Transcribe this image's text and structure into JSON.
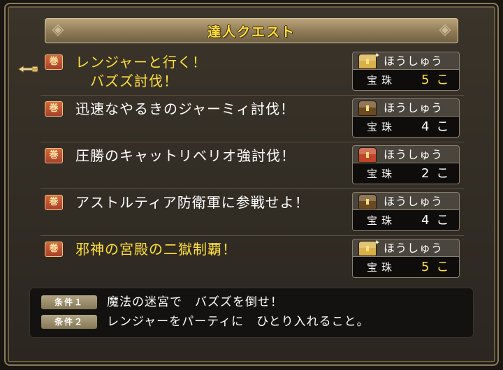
{
  "window": {
    "title": "達人クエスト"
  },
  "quests": [
    {
      "label": "レンジャーと行く！\n　バズズ討伐！",
      "highlight": true,
      "selected": true,
      "reward_header": "ほうしゅう",
      "reward_item": "宝珠",
      "reward_qty": "5こ",
      "chest_color": "#d9b04a",
      "chest_sparkle": true
    },
    {
      "label": "迅速なやるきのジャーミィ討伐！",
      "highlight": false,
      "selected": false,
      "reward_header": "ほうしゅう",
      "reward_item": "宝珠",
      "reward_qty": "4こ",
      "chest_color": "#6b4a22",
      "chest_sparkle": false
    },
    {
      "label": "圧勝のキャットリベリオ強討伐！",
      "highlight": false,
      "selected": false,
      "reward_header": "ほうしゅう",
      "reward_item": "宝珠",
      "reward_qty": "2こ",
      "chest_color": "#c0442a",
      "chest_sparkle": false
    },
    {
      "label": "アストルティア防衛軍に参戦せよ！",
      "highlight": false,
      "selected": false,
      "reward_header": "ほうしゅう",
      "reward_item": "宝珠",
      "reward_qty": "4こ",
      "chest_color": "#6b4a22",
      "chest_sparkle": false
    },
    {
      "label": "邪神の宮殿の二獄制覇！",
      "highlight": true,
      "selected": false,
      "reward_header": "ほうしゅう",
      "reward_item": "宝珠",
      "reward_qty": "5こ",
      "chest_color": "#d9b04a",
      "chest_sparkle": true
    }
  ],
  "conditions": [
    {
      "badge": "条件１",
      "text": "魔法の迷宮で　バズズを倒せ！"
    },
    {
      "badge": "条件２",
      "text": "レンジャーをパーティに　ひとり入れること。"
    }
  ],
  "icons": {
    "quest_icon": "quest-scroll-icon",
    "reward_icon": "treasure-chest-icon",
    "cursor_icon": "hand-cursor-icon",
    "title_deco": "ornament-icon"
  },
  "colors": {
    "highlight_text": "#ffe03a",
    "normal_text": "#ffffff"
  }
}
